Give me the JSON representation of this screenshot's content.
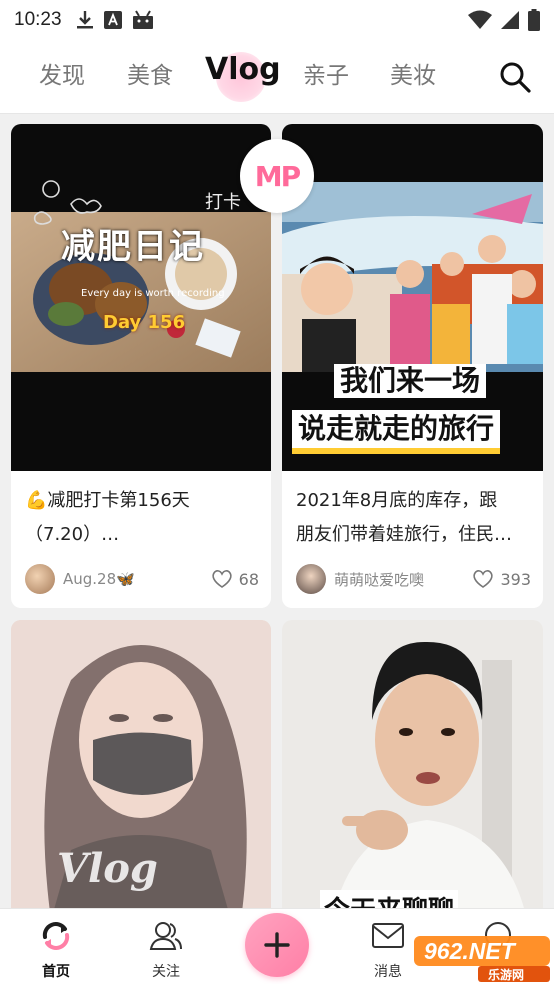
{
  "status_bar": {
    "time": "10:23"
  },
  "tabs": [
    {
      "label": "发现",
      "active": false
    },
    {
      "label": "美食",
      "active": false
    },
    {
      "label": "Vlog",
      "active": true
    },
    {
      "label": "亲子",
      "active": false
    },
    {
      "label": "美妆",
      "active": false
    }
  ],
  "badge": {
    "text": "MP"
  },
  "cards": [
    {
      "image_overlay_title": "减肥日记",
      "image_overlay_caption": "Every day is worth recording",
      "image_overlay_day": "Day 156",
      "image_overlay_corner": "打卡",
      "title_line1": "💪减肥打卡第156天",
      "title_line2": "（7.20）…",
      "author": "Aug.28🦋",
      "likes": "68"
    },
    {
      "image_overlay_line1": "我们来一场",
      "image_overlay_line2": "说走就走的旅行",
      "title_line1": "2021年8月底的库存，跟",
      "title_line2": "朋友们带着娃旅行，住民…",
      "author": "萌萌哒爱吃噢",
      "likes": "393"
    },
    {
      "image_overlay_text": "Vlog"
    },
    {
      "image_overlay_text": "今天来聊聊"
    }
  ],
  "bottom_nav": {
    "home": "首页",
    "follow": "关注",
    "messages": "消息"
  },
  "watermark": {
    "text": "962.NET",
    "subtext": "乐游网"
  },
  "colors": {
    "accent": "#ff7fa6",
    "badge": "#ff6a9a"
  }
}
